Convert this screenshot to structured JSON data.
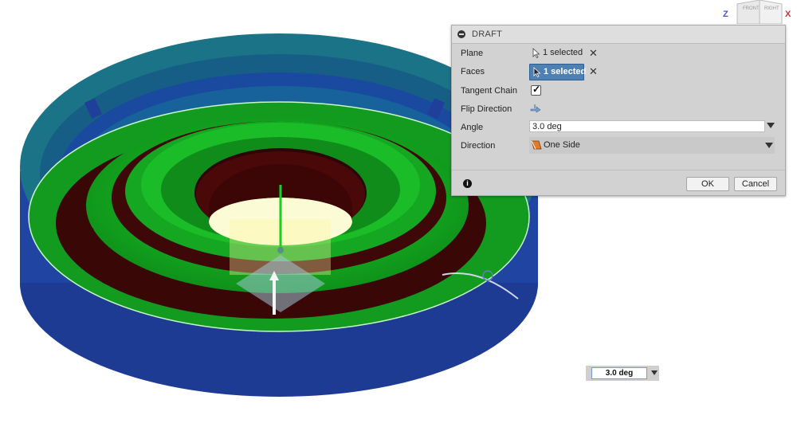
{
  "dialog": {
    "title": "DRAFT",
    "plane": {
      "label": "Plane",
      "selection": "1 selected"
    },
    "faces": {
      "label": "Faces",
      "selection": "1 selected"
    },
    "tangent_chain": {
      "label": "Tangent Chain",
      "checked": true
    },
    "flip_direction": {
      "label": "Flip Direction"
    },
    "angle": {
      "label": "Angle",
      "value": "3.0 deg"
    },
    "direction": {
      "label": "Direction",
      "value": "One Side"
    },
    "ok_label": "OK",
    "cancel_label": "Cancel"
  },
  "floating_input": {
    "value": "3.0 deg"
  },
  "viewcube": {
    "faces": [
      "FRONT",
      "RIGHT"
    ],
    "axis_z": "Z",
    "axis_x": "X"
  },
  "colors": {
    "outer_wall": "#1f3f9a",
    "outer_wall_top": "#1e7c8c",
    "draft_faces": "#12a61c",
    "inner_dark": "#4a0a0a",
    "selection_blue": "#4f80b4"
  }
}
